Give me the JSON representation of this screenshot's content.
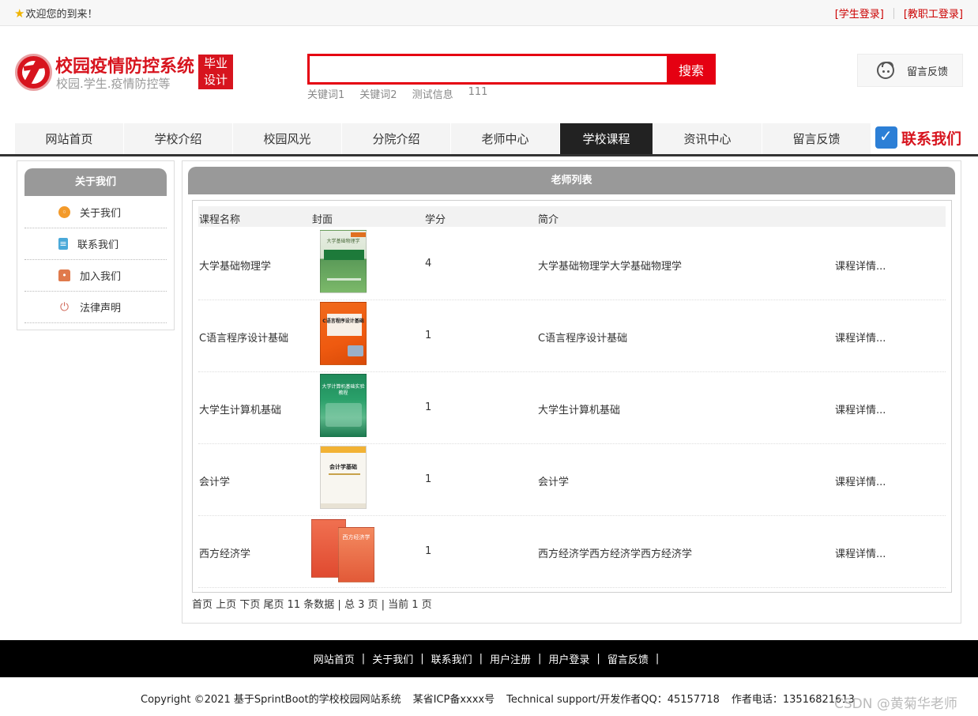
{
  "topbar": {
    "welcome": "欢迎您的到来！",
    "student_login": "[学生登录]",
    "staff_login": "[教职工登录]"
  },
  "header": {
    "site_title": "校园疫情防控系统",
    "site_subtitle": "校园.学生.疫情防控等",
    "badge_line1": "毕业",
    "badge_line2": "设计",
    "search_value": "",
    "search_button": "搜索",
    "keywords": [
      "关键词1",
      "关键词2",
      "测试信息",
      "111"
    ],
    "feedback_button": "留言反馈"
  },
  "nav": {
    "items": [
      "网站首页",
      "学校介绍",
      "校园风光",
      "分院介绍",
      "老师中心",
      "学校课程",
      "资讯中心",
      "留言反馈"
    ],
    "active": "学校课程",
    "contact_us": "联系我们"
  },
  "sidebar": {
    "title": "关于我们",
    "items": [
      {
        "label": "关于我们",
        "icon": "circle-info-icon"
      },
      {
        "label": "联系我们",
        "icon": "clipboard-icon"
      },
      {
        "label": "加入我们",
        "icon": "lock-icon"
      },
      {
        "label": "法律声明",
        "icon": "power-icon"
      }
    ]
  },
  "main": {
    "title": "老师列表",
    "columns": [
      "课程名称",
      "封面",
      "学分",
      "简介",
      ""
    ],
    "rows": [
      {
        "name": "大学基础物理学",
        "credit": "4",
        "intro": "大学基础物理学大学基础物理学",
        "detail": "课程详情...",
        "cover_text": "大学基础物理学"
      },
      {
        "name": "C语言程序设计基础",
        "credit": "1",
        "intro": "C语言程序设计基础",
        "detail": "课程详情...",
        "cover_text": "C语言程序设计基础"
      },
      {
        "name": "大学生计算机基础",
        "credit": "1",
        "intro": "大学生计算机基础",
        "detail": "课程详情...",
        "cover_text": "大学计算机基础实验教程"
      },
      {
        "name": "会计学",
        "credit": "1",
        "intro": "会计学",
        "detail": "课程详情...",
        "cover_text": "会计学基础"
      },
      {
        "name": "西方经济学",
        "credit": "1",
        "intro": "西方经济学西方经济学西方经济学",
        "detail": "课程详情...",
        "cover_text": "西方经济学"
      }
    ],
    "pager": {
      "first": "首页",
      "prev": "上页",
      "next": "下页",
      "last": "尾页",
      "summary": "11 条数据 | 总 3 页 | 当前 1 页"
    }
  },
  "footer": {
    "links": [
      "网站首页",
      "关于我们",
      "联系我们",
      "用户注册",
      "用户登录",
      "留言反馈"
    ],
    "separator": "|",
    "copyright": "Copyright ©2021 基于SprintBoot的学校校园网站系统",
    "icp": "某省ICP备xxxx号",
    "support": "Technical support/开发作者QQ：45157718",
    "phone": "作者电话：13516821613",
    "watermark": "CSDN @黄菊华老师"
  },
  "colors": {
    "brand_red": "#d7141e",
    "search_red": "#e50012",
    "nav_active": "#222222",
    "panel_title": "#999999"
  }
}
